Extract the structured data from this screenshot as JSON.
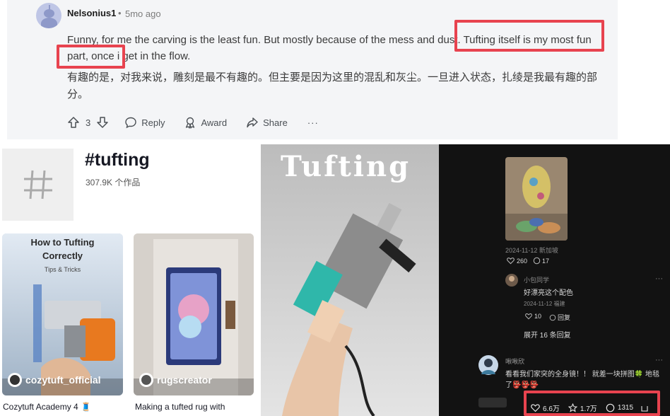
{
  "reddit_comment": {
    "username": "Nelsonius1",
    "separator": "•",
    "time": "5mo ago",
    "text": "Funny, for me the carving is the least fun. But mostly because of the mess and dust. Tufting itself is my most fun part, once i get in the flow.",
    "translation": "有趣的是，对我来说，雕刻是最不有趣的。但主要是因为这里的混乱和灰尘。一旦进入状态，扎绫是我最有趣的部分。",
    "vote_count": "3",
    "reply_label": "Reply",
    "award_label": "Award",
    "share_label": "Share",
    "more_label": "···",
    "highlight_color": "#e8434f"
  },
  "hashtag_page": {
    "title": "#tufting",
    "count": "307.9K 个作品",
    "cards": [
      {
        "overlay_title_line1": "How to Tufting",
        "overlay_title_line2": "Correctly",
        "overlay_subtitle": "Tips & Tricks",
        "username": "cozytuft_official",
        "caption": "Cozytuft Academy 4 🧵"
      },
      {
        "username": "rugscreator",
        "caption": "Making a tufted rug with"
      }
    ]
  },
  "video": {
    "title": "Tufting"
  },
  "comments_panel": {
    "post_date": "2024-11-12 新加坡",
    "post_likes": "260",
    "post_replies": "17",
    "reply_user": "小包同学",
    "reply_text": "好漂亮这个配色",
    "reply_date": "2024-11-12 福建",
    "reply_likes": "10",
    "reply_label": "回复",
    "expand_label": "展开 16 条回复",
    "more_label": "···",
    "comment_user": "啾啾欣",
    "comment_text_line1": "看看我们家突的全身镜！！ 就差一块拼图🍀 地毯",
    "comment_text_line2": "了👺👺👺",
    "stats": {
      "likes": "6.6万",
      "favorites": "1.7万",
      "comments": "1315"
    }
  }
}
